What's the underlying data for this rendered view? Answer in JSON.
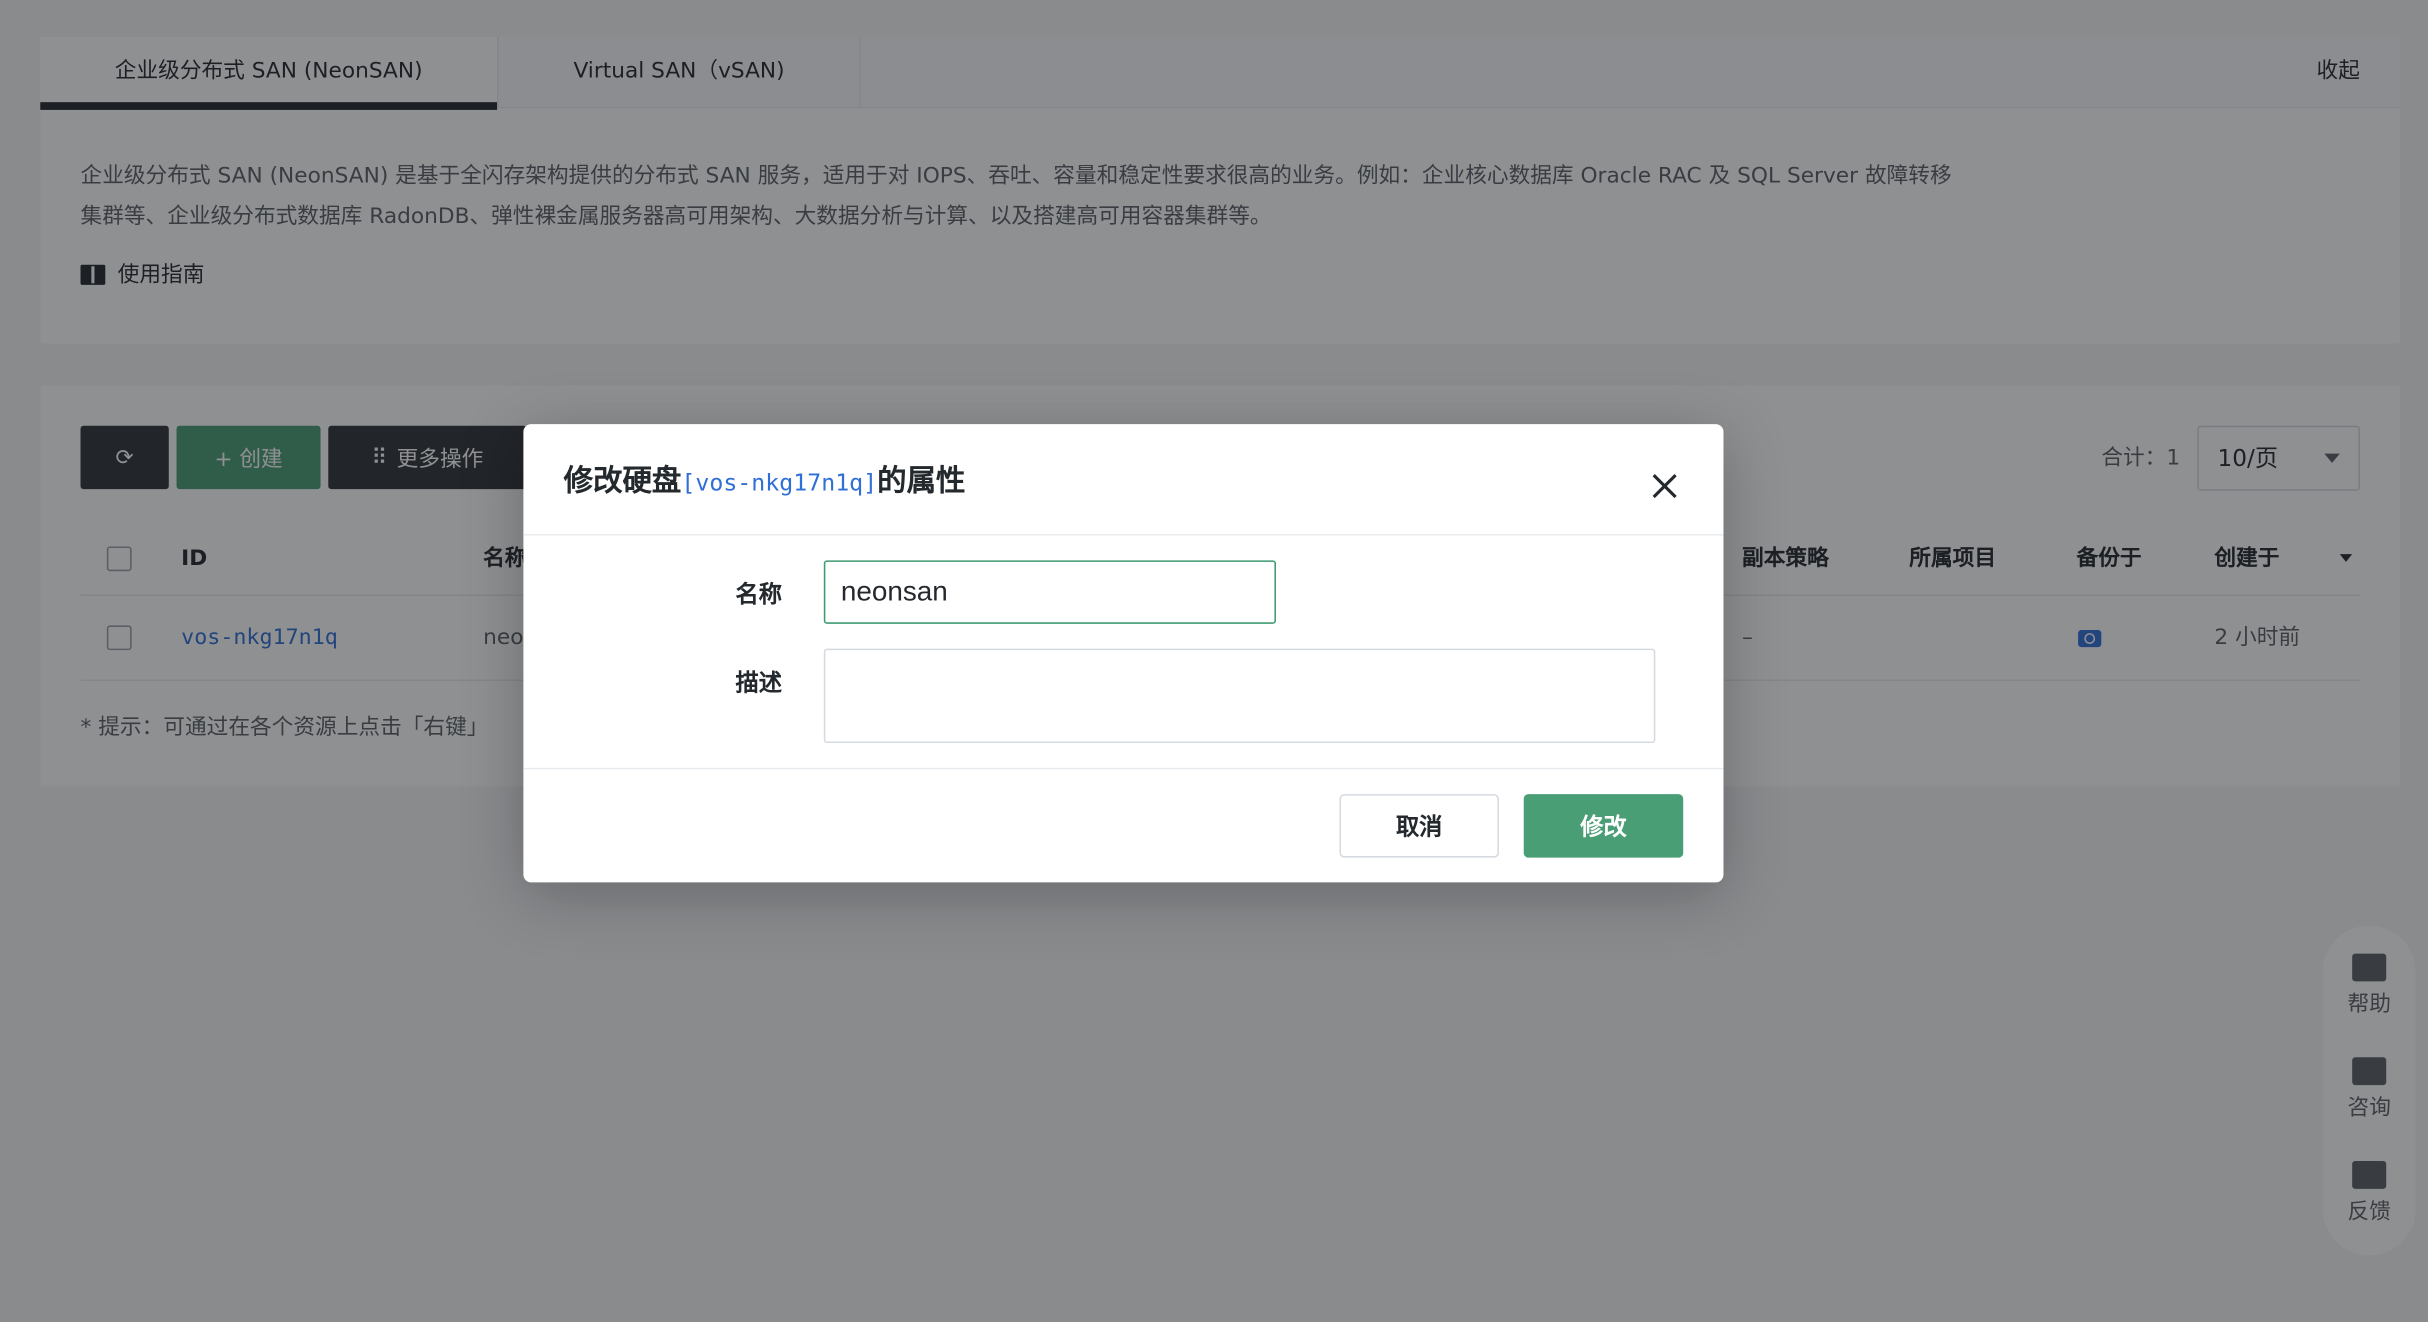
{
  "tabs": [
    {
      "label": "企业级分布式 SAN (NeonSAN)"
    },
    {
      "label": "Virtual SAN（vSAN)"
    }
  ],
  "collapse_label": "收起",
  "intro": "企业级分布式 SAN (NeonSAN) 是基于全闪存架构提供的分布式 SAN 服务，适用于对 IOPS、吞吐、容量和稳定性要求很高的业务。例如：企业核心数据库 Oracle RAC 及 SQL Server 故障转移集群等、企业级分布式数据库 RadonDB、弹性裸金属服务器高可用架构、大数据分析与计算、以及搭建高可用容器集群等。",
  "guide_label": "使用指南",
  "toolbar": {
    "create_label": "+ 创建",
    "more_label": "更多操作",
    "total_label": "合计：1",
    "page_size": "10/页"
  },
  "table": {
    "headers": {
      "id": "ID",
      "name": "名称",
      "replica": "副本策略",
      "project": "所属项目",
      "backup": "备份于",
      "created": "创建于"
    },
    "rows": [
      {
        "id": "vos-nkg17n1q",
        "name": "neo",
        "replica": "–",
        "created": "2 小时前"
      }
    ]
  },
  "tip": "* 提示：可通过在各个资源上点击「右键」",
  "float_help": {
    "help": "帮助",
    "consult": "咨询",
    "feedback": "反馈"
  },
  "modal": {
    "title_prefix": "修改硬盘",
    "title_id": "[vos-nkg17n1q]",
    "title_suffix": "的属性",
    "name_label": "名称",
    "name_value": "neonsan",
    "desc_label": "描述",
    "desc_value": "",
    "cancel_label": "取消",
    "submit_label": "修改"
  },
  "colors": {
    "accent_green": "#4a9e76",
    "link_blue": "#2f6fd6"
  }
}
